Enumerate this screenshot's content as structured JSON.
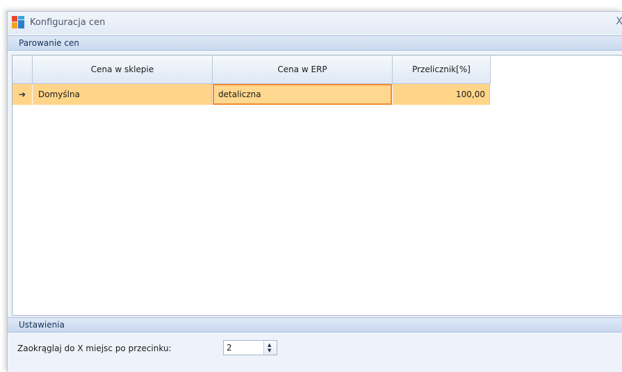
{
  "window": {
    "title": "Konfiguracja cen",
    "close_label": "X"
  },
  "pricing_group": {
    "title": "Parowanie cen"
  },
  "grid": {
    "columns": [
      "Cena w sklepie",
      "Cena w ERP",
      "Przelicznik[%]"
    ],
    "rows": [
      {
        "indicator": "➔",
        "shop_price": "Domyślna",
        "erp_price": "detaliczna",
        "factor": "100,00"
      }
    ]
  },
  "settings_group": {
    "title": "Ustawienia"
  },
  "rounding": {
    "label": "Zaokrąglaj do X miejsc po przecinku:",
    "value": "2"
  },
  "colors": {
    "selected_row": "#ffd58a",
    "edit_border": "#f08a32",
    "group_header": "#c9d9ef"
  }
}
